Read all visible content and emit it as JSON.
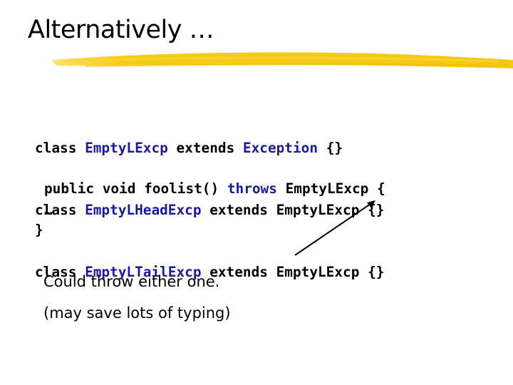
{
  "slide": {
    "title": "Alternatively …",
    "code_lines": [
      {
        "kw": "class",
        "name": "EmptyLExcp",
        "ext": "extends",
        "parent": "Exception",
        "body": "{}"
      },
      {
        "kw": "class",
        "name": "EmptyLHeadExcp",
        "ext": "extends",
        "parent": "EmptyLExcp",
        "body": "{}"
      },
      {
        "kw": "class",
        "name": "EmptyLTailExcp",
        "ext": "extends",
        "parent": "EmptyLExcp",
        "body": "{}"
      }
    ],
    "method": {
      "signature": "public void foolist()",
      "throws_kw": "throws",
      "exception": "EmptyLExcp {"
    },
    "ellipsis": "…",
    "closing_brace": "}",
    "notes": [
      "Could throw either one.",
      "(may save lots of typing)"
    ],
    "colors": {
      "keyword_blue": "#1a1a9e",
      "highlight_yellow": "#f5c800"
    }
  }
}
